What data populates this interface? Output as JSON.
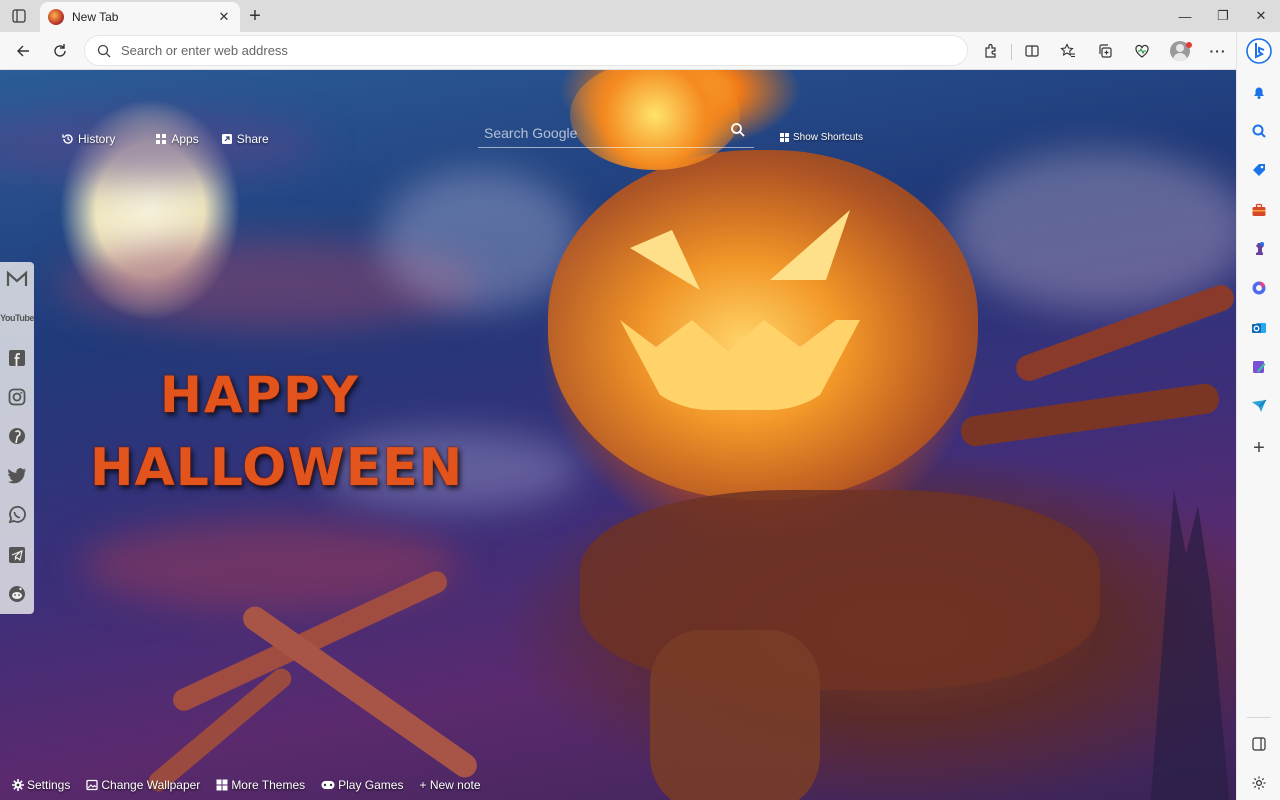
{
  "window": {
    "tab_title": "New Tab",
    "close_tab_glyph": "✕",
    "new_tab_glyph": "+",
    "minimize_glyph": "—",
    "restore_glyph": "❐",
    "close_glyph": "✕"
  },
  "toolbar": {
    "address_placeholder": "Search or enter web address",
    "more_glyph": "···"
  },
  "newtab": {
    "quick_links": [
      {
        "label": "History",
        "icon": "history-icon"
      },
      {
        "label": "Apps",
        "icon": "apps-grid-icon"
      },
      {
        "label": "Share",
        "icon": "share-icon"
      }
    ],
    "search_placeholder": "Search Google",
    "show_shortcuts_label": "Show Shortcuts",
    "greeting_line1": "HAPPY",
    "greeting_line2": "HALLOWEEN",
    "social_links": [
      "gmail-icon",
      "youtube-icon",
      "facebook-icon",
      "instagram-icon",
      "pinterest-icon",
      "twitter-icon",
      "whatsapp-icon",
      "telegram-icon",
      "reddit-icon"
    ],
    "youtube_text": "YouTube",
    "bottom_links": [
      {
        "label": "Settings",
        "icon": "gear-icon"
      },
      {
        "label": "Change Wallpaper",
        "icon": "wallpaper-icon"
      },
      {
        "label": "More Themes",
        "icon": "themes-grid-icon"
      },
      {
        "label": "Play Games",
        "icon": "gamepad-icon"
      },
      {
        "label": "+ New note",
        "icon": ""
      }
    ]
  },
  "sidebar": {
    "items": [
      "bell-icon",
      "search-icon",
      "tag-icon",
      "toolbox-icon",
      "chess-icon",
      "office-icon",
      "outlook-icon",
      "designer-icon",
      "send-icon",
      "add-icon",
      "panel-icon",
      "gear-icon"
    ],
    "add_glyph": "+"
  },
  "colors": {
    "accent": "#0f6cbd",
    "greeting": "#e2541b"
  }
}
